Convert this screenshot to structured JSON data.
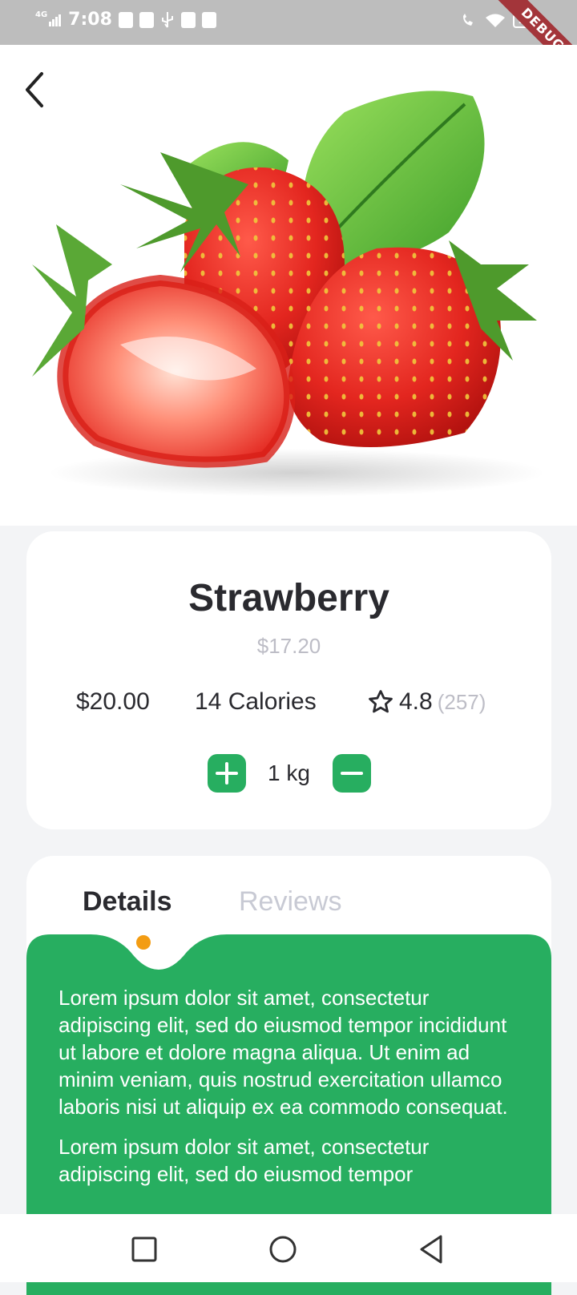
{
  "status_bar": {
    "network": "4G",
    "time": "7:08",
    "battery": "100",
    "debug_label": "DEBUG"
  },
  "product": {
    "name": "Strawberry",
    "old_price": "$17.20",
    "price": "$20.00",
    "calories": "14 Calories",
    "rating": "4.8",
    "rating_count": "(257)",
    "quantity": "1 kg"
  },
  "tabs": [
    {
      "label": "Details",
      "active": true
    },
    {
      "label": "Reviews",
      "active": false
    }
  ],
  "details": {
    "paragraphs": [
      "Lorem ipsum dolor sit amet, consectetur adipiscing elit, sed do eiusmod tempor incididunt ut labore et dolore magna aliqua. Ut enim ad minim veniam, quis nostrud exercitation ullamco laboris nisi ut aliquip ex ea commodo consequat.",
      "Lorem ipsum dolor sit amet, consectetur adipiscing elit, sed do eiusmod tempor"
    ]
  },
  "colors": {
    "accent": "#27ae60",
    "indicator": "#f39c12",
    "ribbon": "#a3353a"
  },
  "icons": [
    "back-arrow-icon",
    "plus-icon",
    "minus-icon",
    "star-icon",
    "nav-recents-icon",
    "nav-home-icon",
    "nav-back-icon"
  ]
}
